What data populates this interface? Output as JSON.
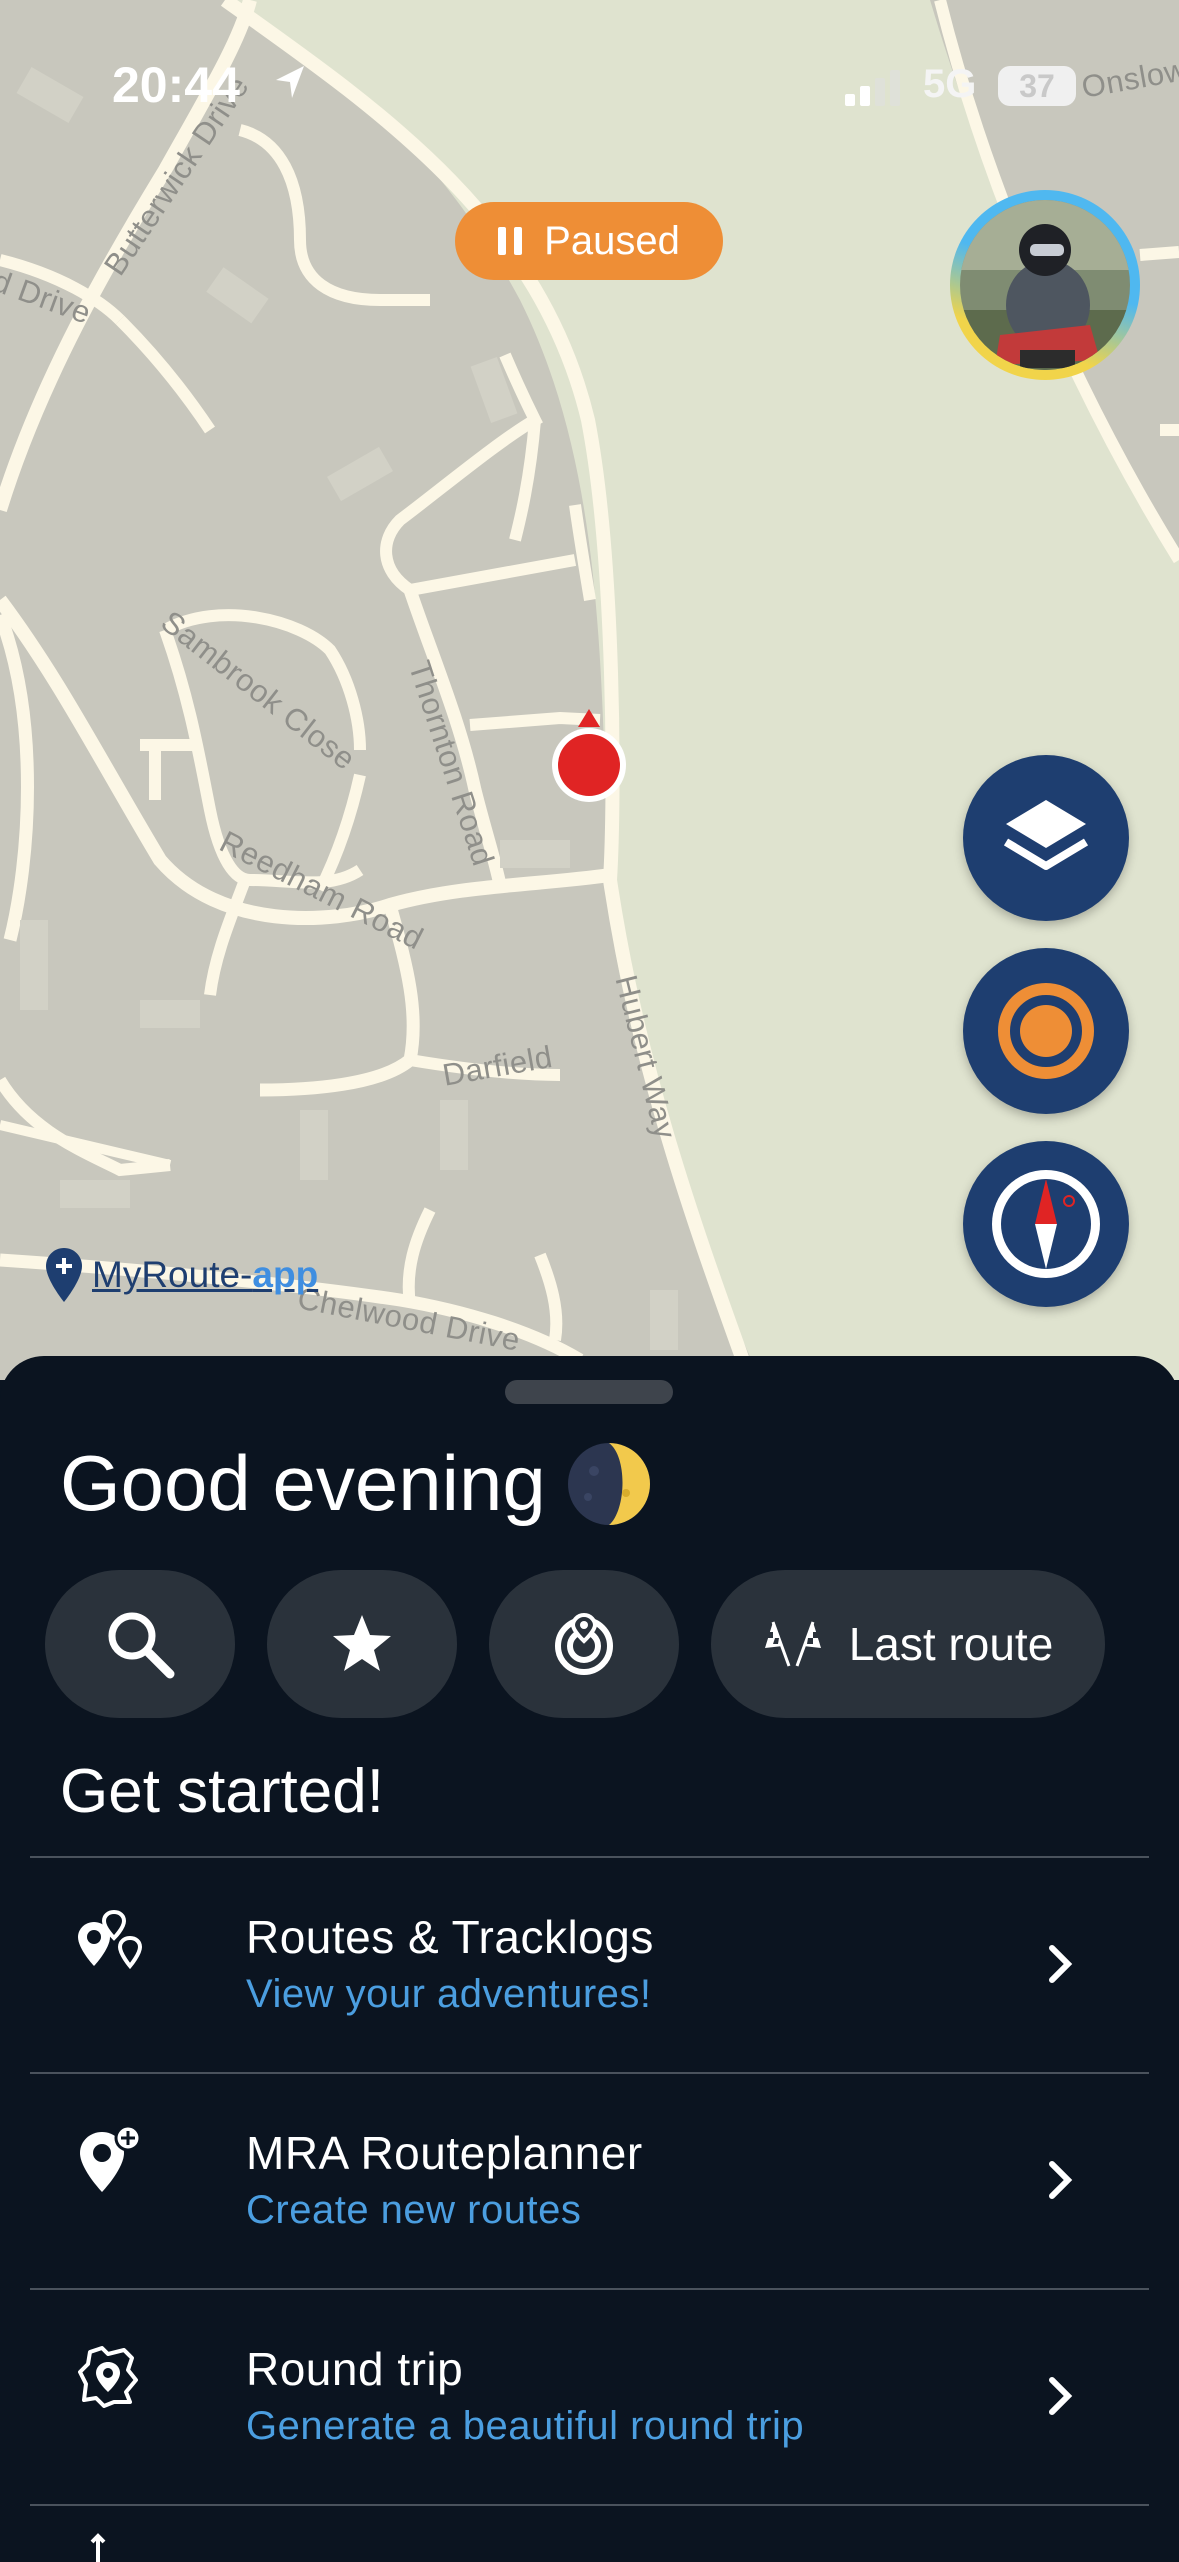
{
  "status_bar": {
    "time": "20:44",
    "network": "5G",
    "battery": "37",
    "location_icon": "location-arrow-icon",
    "signal_icon": "cellular-signal-icon"
  },
  "map": {
    "tracking_status": "Paused",
    "tracking_icon": "pause-icon",
    "street_labels": {
      "butterwick": "Butterwick Drive",
      "drive": "d Drive",
      "onslow": "Onslow",
      "sambrook": "Sambrook Close",
      "thornton": "Thornton Road",
      "reedham": "Reedham Road",
      "darfield": "Darfield",
      "hubert": "Hubert Way",
      "chelwood": "Chelwood Drive"
    },
    "brand": {
      "name": "MyRoute-",
      "suffix": "app"
    },
    "fab_icons": [
      "layers-icon",
      "record-icon",
      "compass-icon"
    ]
  },
  "sheet": {
    "greeting": "Good evening",
    "greeting_icon": "moon-icon",
    "quick_actions": [
      {
        "icon": "search-icon"
      },
      {
        "icon": "star-icon"
      },
      {
        "icon": "round-trip-icon"
      },
      {
        "icon": "checkered-flags-icon",
        "label": "Last route"
      }
    ],
    "section_title": "Get started!",
    "menu": [
      {
        "title": "Routes & Tracklogs",
        "subtitle": "View your adventures!",
        "icon": "map-pins-icon"
      },
      {
        "title": "MRA Routeplanner",
        "subtitle": "Create new routes",
        "icon": "add-pin-icon"
      },
      {
        "title": "Round trip",
        "subtitle": "Generate a beautiful round trip",
        "icon": "round-trip-map-icon"
      }
    ]
  },
  "colors": {
    "map_land": "#c8c7bd",
    "map_park": "#dfe3cf",
    "street": "#fcf7e6",
    "paused_orange": "#ee8e36",
    "fab_navy": "#1e3e70",
    "sheet_bg": "#0b1420",
    "chip_bg": "#2a323b",
    "link_blue": "#4b9ee0",
    "marker_red": "#e02424"
  }
}
